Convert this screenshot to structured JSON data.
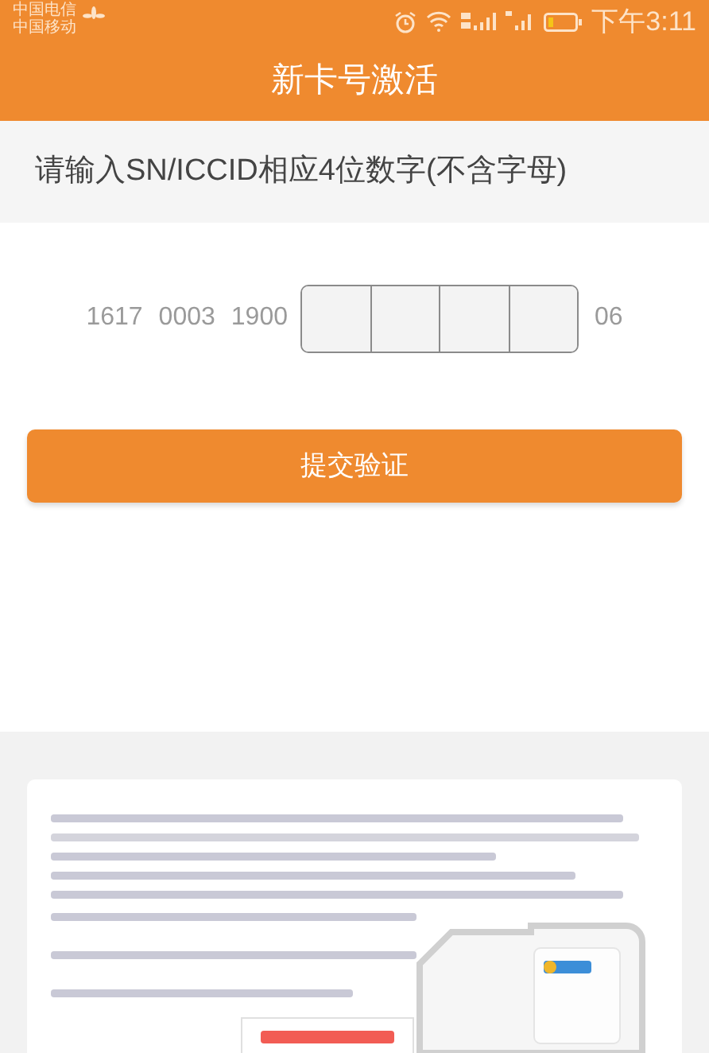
{
  "status_bar": {
    "carriers": [
      "中国电信",
      "中国移动"
    ],
    "time": "下午3:11"
  },
  "header": {
    "title": "新卡号激活"
  },
  "prompt": "请输入SN/ICCID相应4位数字(不含字母)",
  "serial": {
    "prefix": [
      "1617",
      "0003",
      "1900"
    ],
    "suffix": "06"
  },
  "submit_button": "提交验证"
}
